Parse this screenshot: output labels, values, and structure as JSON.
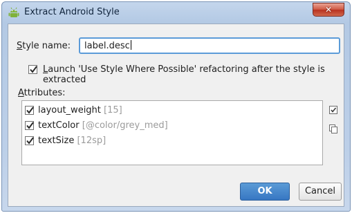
{
  "window": {
    "title": "Extract Android Style"
  },
  "form": {
    "style_name_label_mnemonic": "S",
    "style_name_label_rest": "tyle name:",
    "style_name_value": "label.desc",
    "refactor_checked": true,
    "refactor_label_mnemonic": "L",
    "refactor_label_rest": "aunch 'Use Style Where Possible' refactoring after the style is extracted",
    "attributes_label_mnemonic": "A",
    "attributes_label_rest": "ttributes:"
  },
  "attributes": [
    {
      "name": "layout_weight",
      "value": "[15]",
      "checked": true
    },
    {
      "name": "textColor",
      "value": "[@color/grey_med]",
      "checked": true
    },
    {
      "name": "textSize",
      "value": "[12sp]",
      "checked": true
    }
  ],
  "side_icons": [
    "select-all-icon",
    "copy-icon"
  ],
  "buttons": {
    "ok": "OK",
    "cancel": "Cancel"
  },
  "colors": {
    "ok_button": "#3a7bc8",
    "focus_border": "#5b9bd8",
    "close_button": "#c9462f"
  }
}
